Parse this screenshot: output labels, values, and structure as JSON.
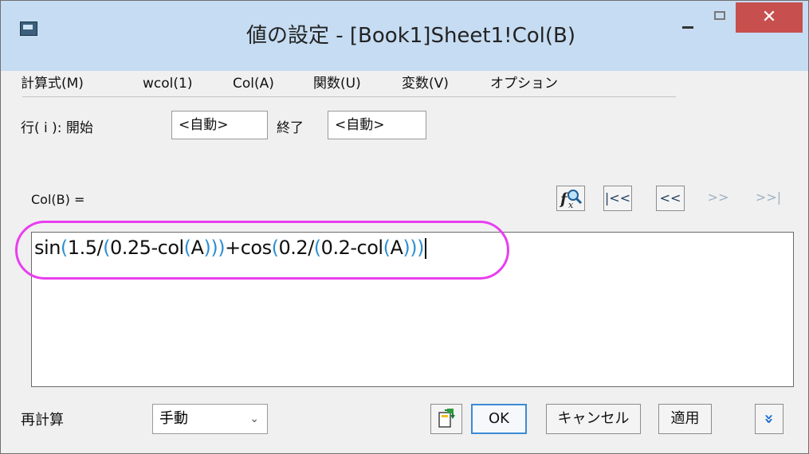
{
  "window": {
    "title": "値の設定 - [Book1]Sheet1!Col(B)",
    "close_glyph": "✕"
  },
  "menu": [
    {
      "label": "計算式(M)"
    },
    {
      "label": "wcol(1)"
    },
    {
      "label": "Col(A)"
    },
    {
      "label": "関数(U)"
    },
    {
      "label": "変数(V)"
    },
    {
      "label": "オプション"
    }
  ],
  "rows": {
    "label": "行( i ): 開始",
    "start_value": "<自動>",
    "end_label": "終了",
    "end_value": "<自動>"
  },
  "formula": {
    "label": "Col(B) =",
    "text": "sin(1.5/(0.25-col(A)))+cos(0.2/(0.2-col(A)))"
  },
  "nav_buttons": {
    "first": "|<<",
    "prev": "<<",
    "next": ">>",
    "last": ">>|"
  },
  "footer": {
    "recalc_label": "再計算",
    "recalc_value": "手動",
    "ok_label": "OK",
    "cancel_label": "キャンセル",
    "apply_label": "適用",
    "expand_glyph": "»"
  },
  "colors": {
    "titlebar": "#c6dcf2",
    "close_button": "#c7504e",
    "paren_highlight": "#2e8fd0",
    "annotation_circle": "#e83ef0",
    "default_button_border": "#3c8ad4"
  },
  "icons": [
    "app-icon",
    "minimize-icon",
    "maximize-icon",
    "close-icon",
    "function-search-icon",
    "open-file-icon",
    "chevron-down-icon",
    "expand-icon"
  ]
}
